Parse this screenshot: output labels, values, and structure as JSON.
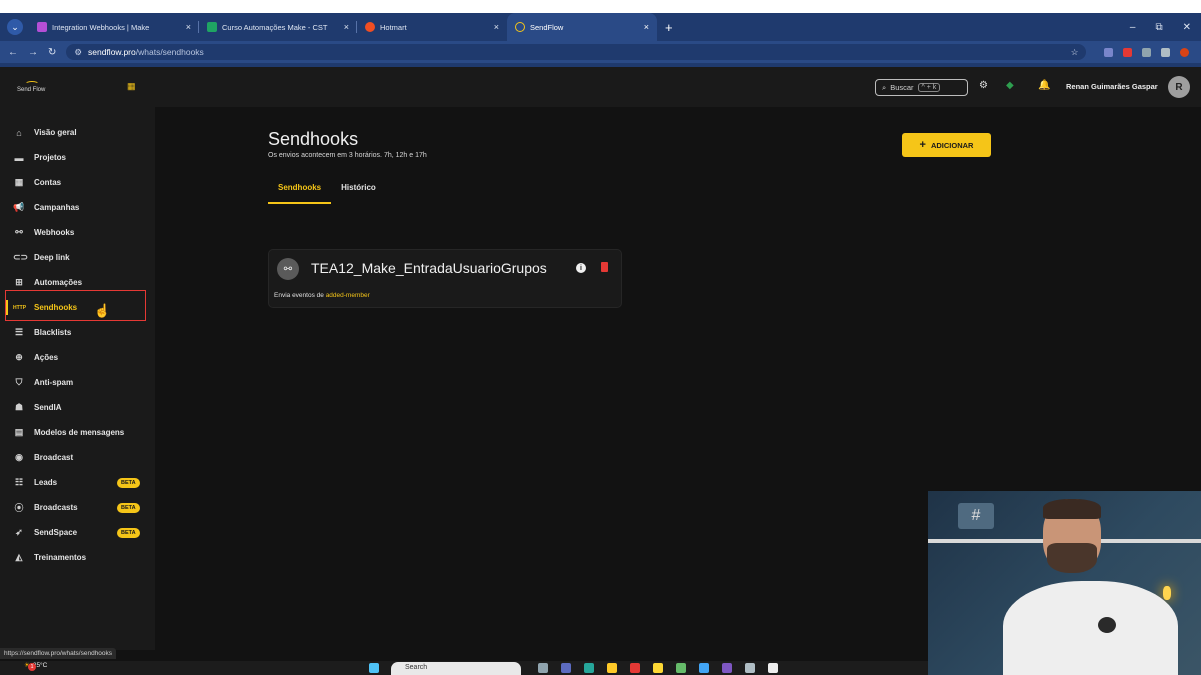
{
  "browser": {
    "tabs": [
      {
        "title": "Integration Webhooks | Make",
        "fav_color": "#b44fd6"
      },
      {
        "title": "Curso Automações Make - CST",
        "fav_color": "#1fa463"
      },
      {
        "title": "Hotmart",
        "fav_color": "#f04e23"
      },
      {
        "title": "SendFlow",
        "fav_color": "#f5c518",
        "active": true
      }
    ],
    "new_tab": "+",
    "url_host": "sendflow.pro",
    "url_path": "/whats/sendhooks"
  },
  "brand": {
    "logo_text": "Send Flow",
    "accent": "#f5c518"
  },
  "sidebar": {
    "items": [
      {
        "label": "Visão geral",
        "icon": "home-icon",
        "glyph": "⌂"
      },
      {
        "label": "Projetos",
        "icon": "folder-icon",
        "glyph": "▬"
      },
      {
        "label": "Contas",
        "icon": "qr-icon",
        "glyph": "▦"
      },
      {
        "label": "Campanhas",
        "icon": "megaphone-icon",
        "glyph": "📢"
      },
      {
        "label": "Webhooks",
        "icon": "webhook-icon",
        "glyph": "⚯"
      },
      {
        "label": "Deep link",
        "icon": "link-icon",
        "glyph": "⊂⊃"
      },
      {
        "label": "Automações",
        "icon": "flow-icon",
        "glyph": "⊞"
      },
      {
        "label": "Sendhooks",
        "icon": "http-icon",
        "glyph": "HTTP",
        "active": true
      },
      {
        "label": "Blacklists",
        "icon": "list-icon",
        "glyph": "☰"
      },
      {
        "label": "Ações",
        "icon": "plus-circle-icon",
        "glyph": "⊕"
      },
      {
        "label": "Anti-spam",
        "icon": "shield-icon",
        "glyph": "⛉"
      },
      {
        "label": "SendIA",
        "icon": "robot-icon",
        "glyph": "☗"
      },
      {
        "label": "Modelos de mensagens",
        "icon": "message-icon",
        "glyph": "▤"
      },
      {
        "label": "Broadcast",
        "icon": "broadcast-icon",
        "glyph": "◉"
      },
      {
        "label": "Leads",
        "icon": "people-icon",
        "glyph": "☷",
        "badge": "BETA"
      },
      {
        "label": "Broadcasts",
        "icon": "antenna-icon",
        "glyph": "⦿",
        "badge": "BETA"
      },
      {
        "label": "SendSpace",
        "icon": "rocket-icon",
        "glyph": "➶",
        "badge": "BETA"
      },
      {
        "label": "Treinamentos",
        "icon": "graduation-icon",
        "glyph": "◭"
      }
    ]
  },
  "header": {
    "search_label": "Buscar",
    "search_shortcut": "^ + k",
    "user_name": "Renan Guimarães Gaspar",
    "avatar_initial": "R"
  },
  "main": {
    "title": "Sendhooks",
    "subtitle": "Os envios acontecem em 3 horários. 7h, 12h e 17h",
    "add_button": "ADICIONAR",
    "add_glyph": "+",
    "tabs": [
      {
        "label": "Sendhooks",
        "active": true
      },
      {
        "label": "Histórico",
        "active": false
      }
    ],
    "cards": [
      {
        "title": "TEA12_Make_EntradaUsuarioGrupos",
        "desc_prefix": "Envia eventos de",
        "event": "added-member"
      }
    ]
  },
  "status_url": "https://sendflow.pro/whats/sendhooks",
  "taskbar": {
    "temperature": "25°C",
    "notif_count": "1",
    "search_placeholder": "Search"
  }
}
